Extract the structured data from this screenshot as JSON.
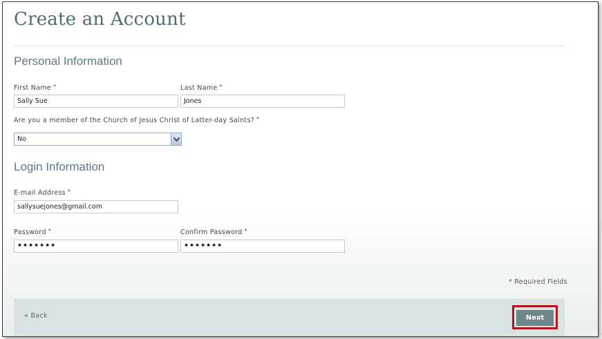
{
  "page": {
    "title": "Create an Account"
  },
  "personal": {
    "heading": "Personal Information",
    "first_name_label": "First Name",
    "first_name_value": "Sally Sue",
    "last_name_label": "Last Name",
    "last_name_value": "Jones",
    "member_question": "Are you a member of the Church of Jesus Christ of Latter-day Saints?",
    "member_selected": "No"
  },
  "login": {
    "heading": "Login Information",
    "email_label": "E-mail Address",
    "email_value": "sallysuejones@gmail.com",
    "password_label": "Password",
    "password_value": "•••••••",
    "confirm_label": "Confirm Password",
    "confirm_value": "•••••••"
  },
  "required_marker": "*",
  "required_note": "* Required Fields",
  "footer": {
    "back_label": "« Back",
    "next_label": "Next"
  },
  "colors": {
    "heading": "#5d7985",
    "footer_bar": "#dae2e4",
    "next_button": "#6c8787",
    "highlight_outline": "#b1161d"
  },
  "icons": {
    "select_arrow": "chevron-down-icon"
  }
}
